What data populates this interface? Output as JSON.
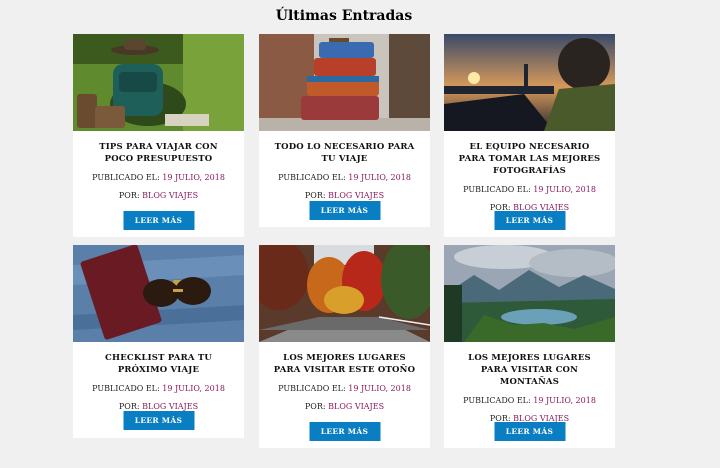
{
  "section": {
    "title": "Últimas Entradas"
  },
  "posts": [
    {
      "title": "TIPS PARA VIAJAR CON POCO PRESUPUESTO",
      "published_label": "PUBLICADO EL:",
      "date": "19 JULIO, 2018",
      "author_label": "POR:",
      "author": "BLOG VIAJES",
      "button": "LEER MÁS",
      "image": "backpack-hat-grass-photo"
    },
    {
      "title": "TODO LO NECESARIO PARA TU VIAJE",
      "published_label": "PUBLICADO EL:",
      "date": "19 JULIO, 2018",
      "author_label": "POR:",
      "author": "BLOG VIAJES",
      "button": "LEER MÁS",
      "image": "stacked-suitcases-photo"
    },
    {
      "title": "EL EQUIPO NECESARIO PARA TOMAR LAS MEJORES FOTOGRAFÍAS",
      "published_label": "PUBLICADO EL:",
      "date": "19 JULIO, 2018",
      "author_label": "POR:",
      "author": "BLOG VIAJES",
      "button": "LEER MÁS",
      "image": "photographer-sunset-photo"
    },
    {
      "title": "CHECKLIST PARA TU PRÓXIMO VIAJE",
      "published_label": "PUBLICADO EL:",
      "date": "19 JULIO, 2018",
      "author_label": "POR:",
      "author": "BLOG VIAJES",
      "button": "LEER MÁS",
      "image": "passport-sunglasses-denim-photo"
    },
    {
      "title": "LOS MEJORES LUGARES PARA VISITAR ESTE OTOÑO",
      "published_label": "PUBLICADO EL:",
      "date": "19 JULIO, 2018",
      "author_label": "POR:",
      "author": "BLOG VIAJES",
      "button": "LEER MÁS",
      "image": "autumn-forest-road-photo"
    },
    {
      "title": "LOS MEJORES LUGARES PARA VISITAR CON MONTAÑAS",
      "published_label": "PUBLICADO EL:",
      "date": "19 JULIO, 2018",
      "author_label": "POR:",
      "author": "BLOG VIAJES",
      "button": "LEER MÁS",
      "image": "mountain-lake-photo"
    }
  ],
  "colors": {
    "accent": "#0a7ec2",
    "link": "#8b1a5e",
    "background": "#f0f0f0"
  }
}
